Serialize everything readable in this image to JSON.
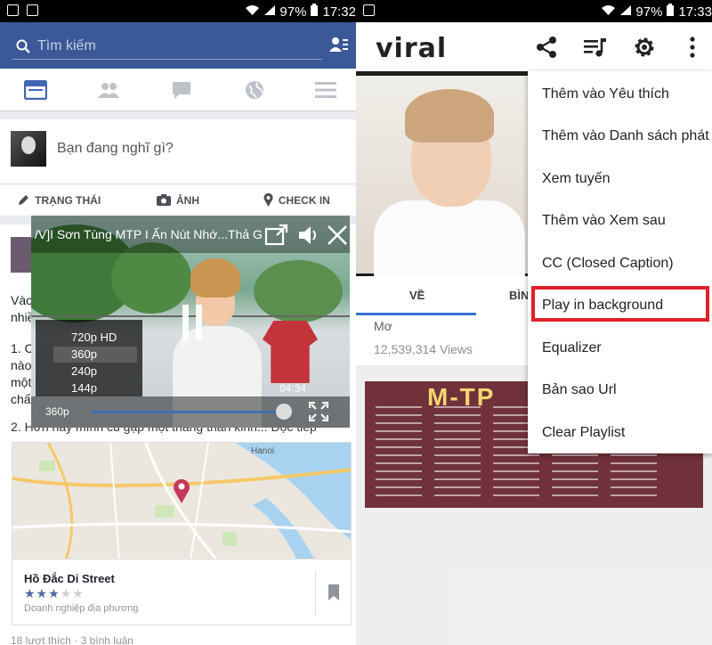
{
  "status_left": {
    "battery": "97%",
    "time": "17:32"
  },
  "status_right": {
    "battery": "97%",
    "time": "17:33"
  },
  "facebook": {
    "search_placeholder": "Tìm kiếm",
    "composer_placeholder": "Bạn đang nghĩ gì?",
    "actions": [
      "TRẠNG THÁI",
      "ẢNH",
      "CHECK IN"
    ],
    "post_lines": [
      "Vào",
      "nhiề",
      "1. C",
      "nào",
      "một",
      "chấ",
      "2. Hơn hay mình cũ gặp một thằng thân kinh... Đọc tiếp"
    ],
    "place_title": "Hồ Đắc Di Street",
    "place_subtitle": "Doanh nghiệp địa phương",
    "counts": "18 lượt thích · 3 bình luận",
    "map_label": "Hanoi"
  },
  "video": {
    "title": "/V]I Sơn Tùng MTP I Ấn Nút Nhớ...Thả Gi",
    "quality_options": [
      "720p HD",
      "360p",
      "240p",
      "144p"
    ],
    "current_quality": "360p",
    "time": "04:34",
    "progress": 0.94
  },
  "viral": {
    "logo": "viral",
    "tabs": [
      "VỀ",
      "BÌN"
    ],
    "video_title_partial": "Mơ",
    "views": "12,539,314 Views",
    "thumb_text": "M-TP",
    "menu_items": [
      "Thêm vào Yêu thích",
      "Thêm vào Danh sách phát",
      "Xem tuyến",
      "Thêm vào Xem sau",
      "CC (Closed Caption)",
      "Play in background",
      "Equalizer",
      "Bản sao Url",
      "Clear Playlist"
    ],
    "highlighted_item": "Play in background"
  },
  "colors": {
    "facebook_blue": "#3b5998",
    "highlight_red": "#e0202a",
    "progress_blue": "#3f6fb2"
  }
}
